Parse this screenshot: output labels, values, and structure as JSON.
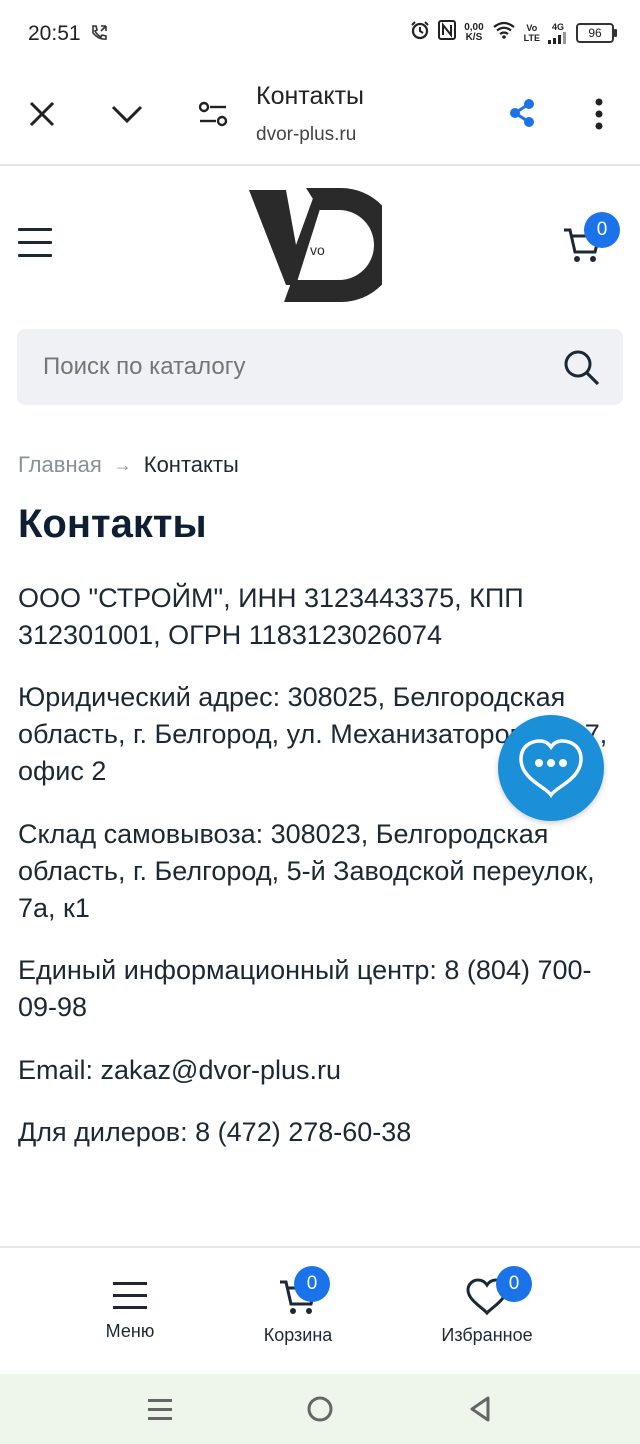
{
  "status_bar": {
    "time": "20:51",
    "net_speed_value": "0,00",
    "net_speed_unit": "K/S",
    "volte_top": "Vo",
    "volte_bottom": "LTE",
    "signal_type": "4G",
    "battery": "96"
  },
  "browser": {
    "title": "Контакты",
    "url": "dvor-plus.ru"
  },
  "header": {
    "cart_count": "0"
  },
  "search": {
    "placeholder": "Поиск по каталогу"
  },
  "breadcrumb": {
    "home": "Главная",
    "separator": "→",
    "current": "Контакты"
  },
  "page": {
    "title": "Контакты",
    "company": "ООО \"СТРОЙМ\", ИНН 3123443375, КПП 312301001, ОГРН 1183123026074",
    "legal_address": "Юридический адрес: 308025, Белгородская область, г. Белгород, ул. Механизаторов, д. 17, офис 2",
    "warehouse": "Склад самовывоза: 308023, Белгородская область, г. Белгород, 5-й Заводской переулок, 7а, к1",
    "info_center": "Единый информационный центр: 8 (804) 700-09-98",
    "email": "Email: zakaz@dvor-plus.ru",
    "dealers": "Для дилеров: 8 (472) 278-60-38"
  },
  "bottom_nav": {
    "menu_label": "Меню",
    "cart_label": "Корзина",
    "cart_count": "0",
    "favorites_label": "Избранное",
    "favorites_count": "0"
  },
  "colors": {
    "accent": "#1a73e8",
    "chat": "#1b8fd8",
    "title": "#0f1f33"
  }
}
